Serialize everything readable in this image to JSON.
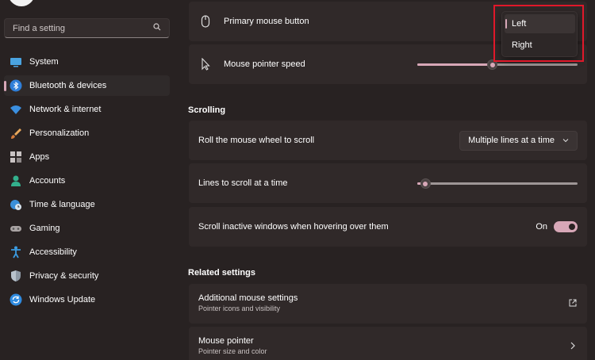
{
  "sidebar": {
    "search_placeholder": "Find a setting",
    "items": [
      {
        "label": "System",
        "icon": "monitor-icon"
      },
      {
        "label": "Bluetooth & devices",
        "icon": "bluetooth-icon",
        "active": true
      },
      {
        "label": "Network & internet",
        "icon": "wifi-icon"
      },
      {
        "label": "Personalization",
        "icon": "brush-icon"
      },
      {
        "label": "Apps",
        "icon": "apps-icon"
      },
      {
        "label": "Accounts",
        "icon": "person-icon"
      },
      {
        "label": "Time & language",
        "icon": "globe-clock-icon"
      },
      {
        "label": "Gaming",
        "icon": "gamepad-icon"
      },
      {
        "label": "Accessibility",
        "icon": "accessibility-icon"
      },
      {
        "label": "Privacy & security",
        "icon": "shield-icon"
      },
      {
        "label": "Windows Update",
        "icon": "update-icon"
      }
    ]
  },
  "mouse": {
    "primary_button_label": "Primary mouse button",
    "pointer_speed_label": "Mouse pointer speed",
    "pointer_speed_value": 0.47
  },
  "flyout": {
    "options": [
      "Left",
      "Right"
    ],
    "selected": "Left"
  },
  "scrolling": {
    "section_title": "Scrolling",
    "wheel_label": "Roll the mouse wheel to scroll",
    "wheel_value": "Multiple lines at a time",
    "lines_label": "Lines to scroll at a time",
    "lines_value": 0.05,
    "inactive_label": "Scroll inactive windows when hovering over them",
    "inactive_state": "On"
  },
  "related": {
    "section_title": "Related settings",
    "additional_title": "Additional mouse settings",
    "additional_sub": "Pointer icons and visibility",
    "pointer_title": "Mouse pointer",
    "pointer_sub": "Pointer size and color"
  },
  "colors": {
    "accent": "#d7a7b7",
    "background": "#282222",
    "card": "#302929",
    "highlight": "#e0182a"
  }
}
